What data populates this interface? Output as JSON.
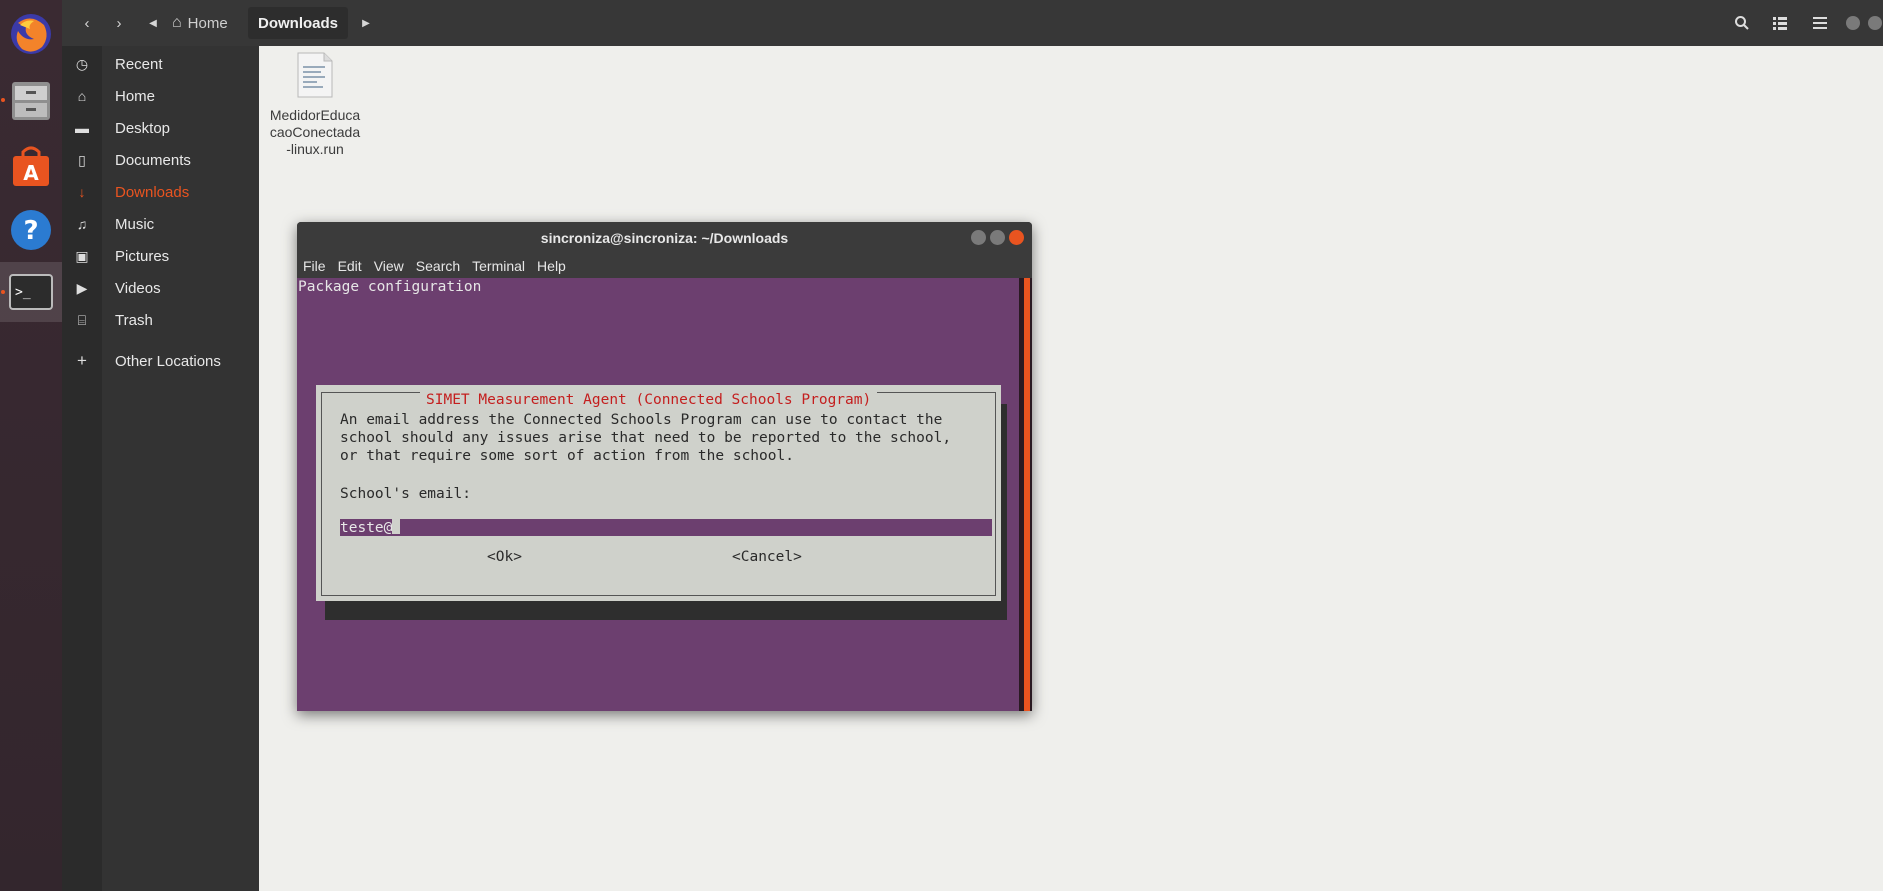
{
  "nav": {
    "breadcrumbs": [
      "Home",
      "Downloads"
    ]
  },
  "sidebar": {
    "items": [
      {
        "label": "Recent",
        "icon": "clock-icon"
      },
      {
        "label": "Home",
        "icon": "home-icon"
      },
      {
        "label": "Desktop",
        "icon": "folder-icon"
      },
      {
        "label": "Documents",
        "icon": "document-icon"
      },
      {
        "label": "Downloads",
        "icon": "download-icon",
        "active": true
      },
      {
        "label": "Music",
        "icon": "music-icon"
      },
      {
        "label": "Pictures",
        "icon": "camera-icon"
      },
      {
        "label": "Videos",
        "icon": "video-icon"
      },
      {
        "label": "Trash",
        "icon": "trash-icon"
      },
      {
        "label": "Other Locations",
        "icon": "plus-icon"
      }
    ]
  },
  "files": [
    {
      "name": "MedidorEducacaoConectada-linux.run",
      "icon": "text-file-icon"
    }
  ],
  "terminal": {
    "title": "sincroniza@sincroniza: ~/Downloads",
    "menu": [
      "File",
      "Edit",
      "View",
      "Search",
      "Terminal",
      "Help"
    ],
    "header_line": "Package configuration",
    "dialog": {
      "title": "SIMET Measurement Agent (Connected Schools Program)",
      "text": "An email address the Connected Schools Program can use to contact the\nschool should any issues arise that need to be reported to the school,\nor that require some sort of action from the school.",
      "field_label": "School's email:",
      "field_value": "teste@",
      "ok_label": "<Ok>",
      "cancel_label": "<Cancel>"
    }
  },
  "colors": {
    "accent": "#e95420",
    "terminal_bg": "#6c3f6f",
    "dialog_bg": "#cfd1cb",
    "dialog_title": "#c41e1e"
  }
}
